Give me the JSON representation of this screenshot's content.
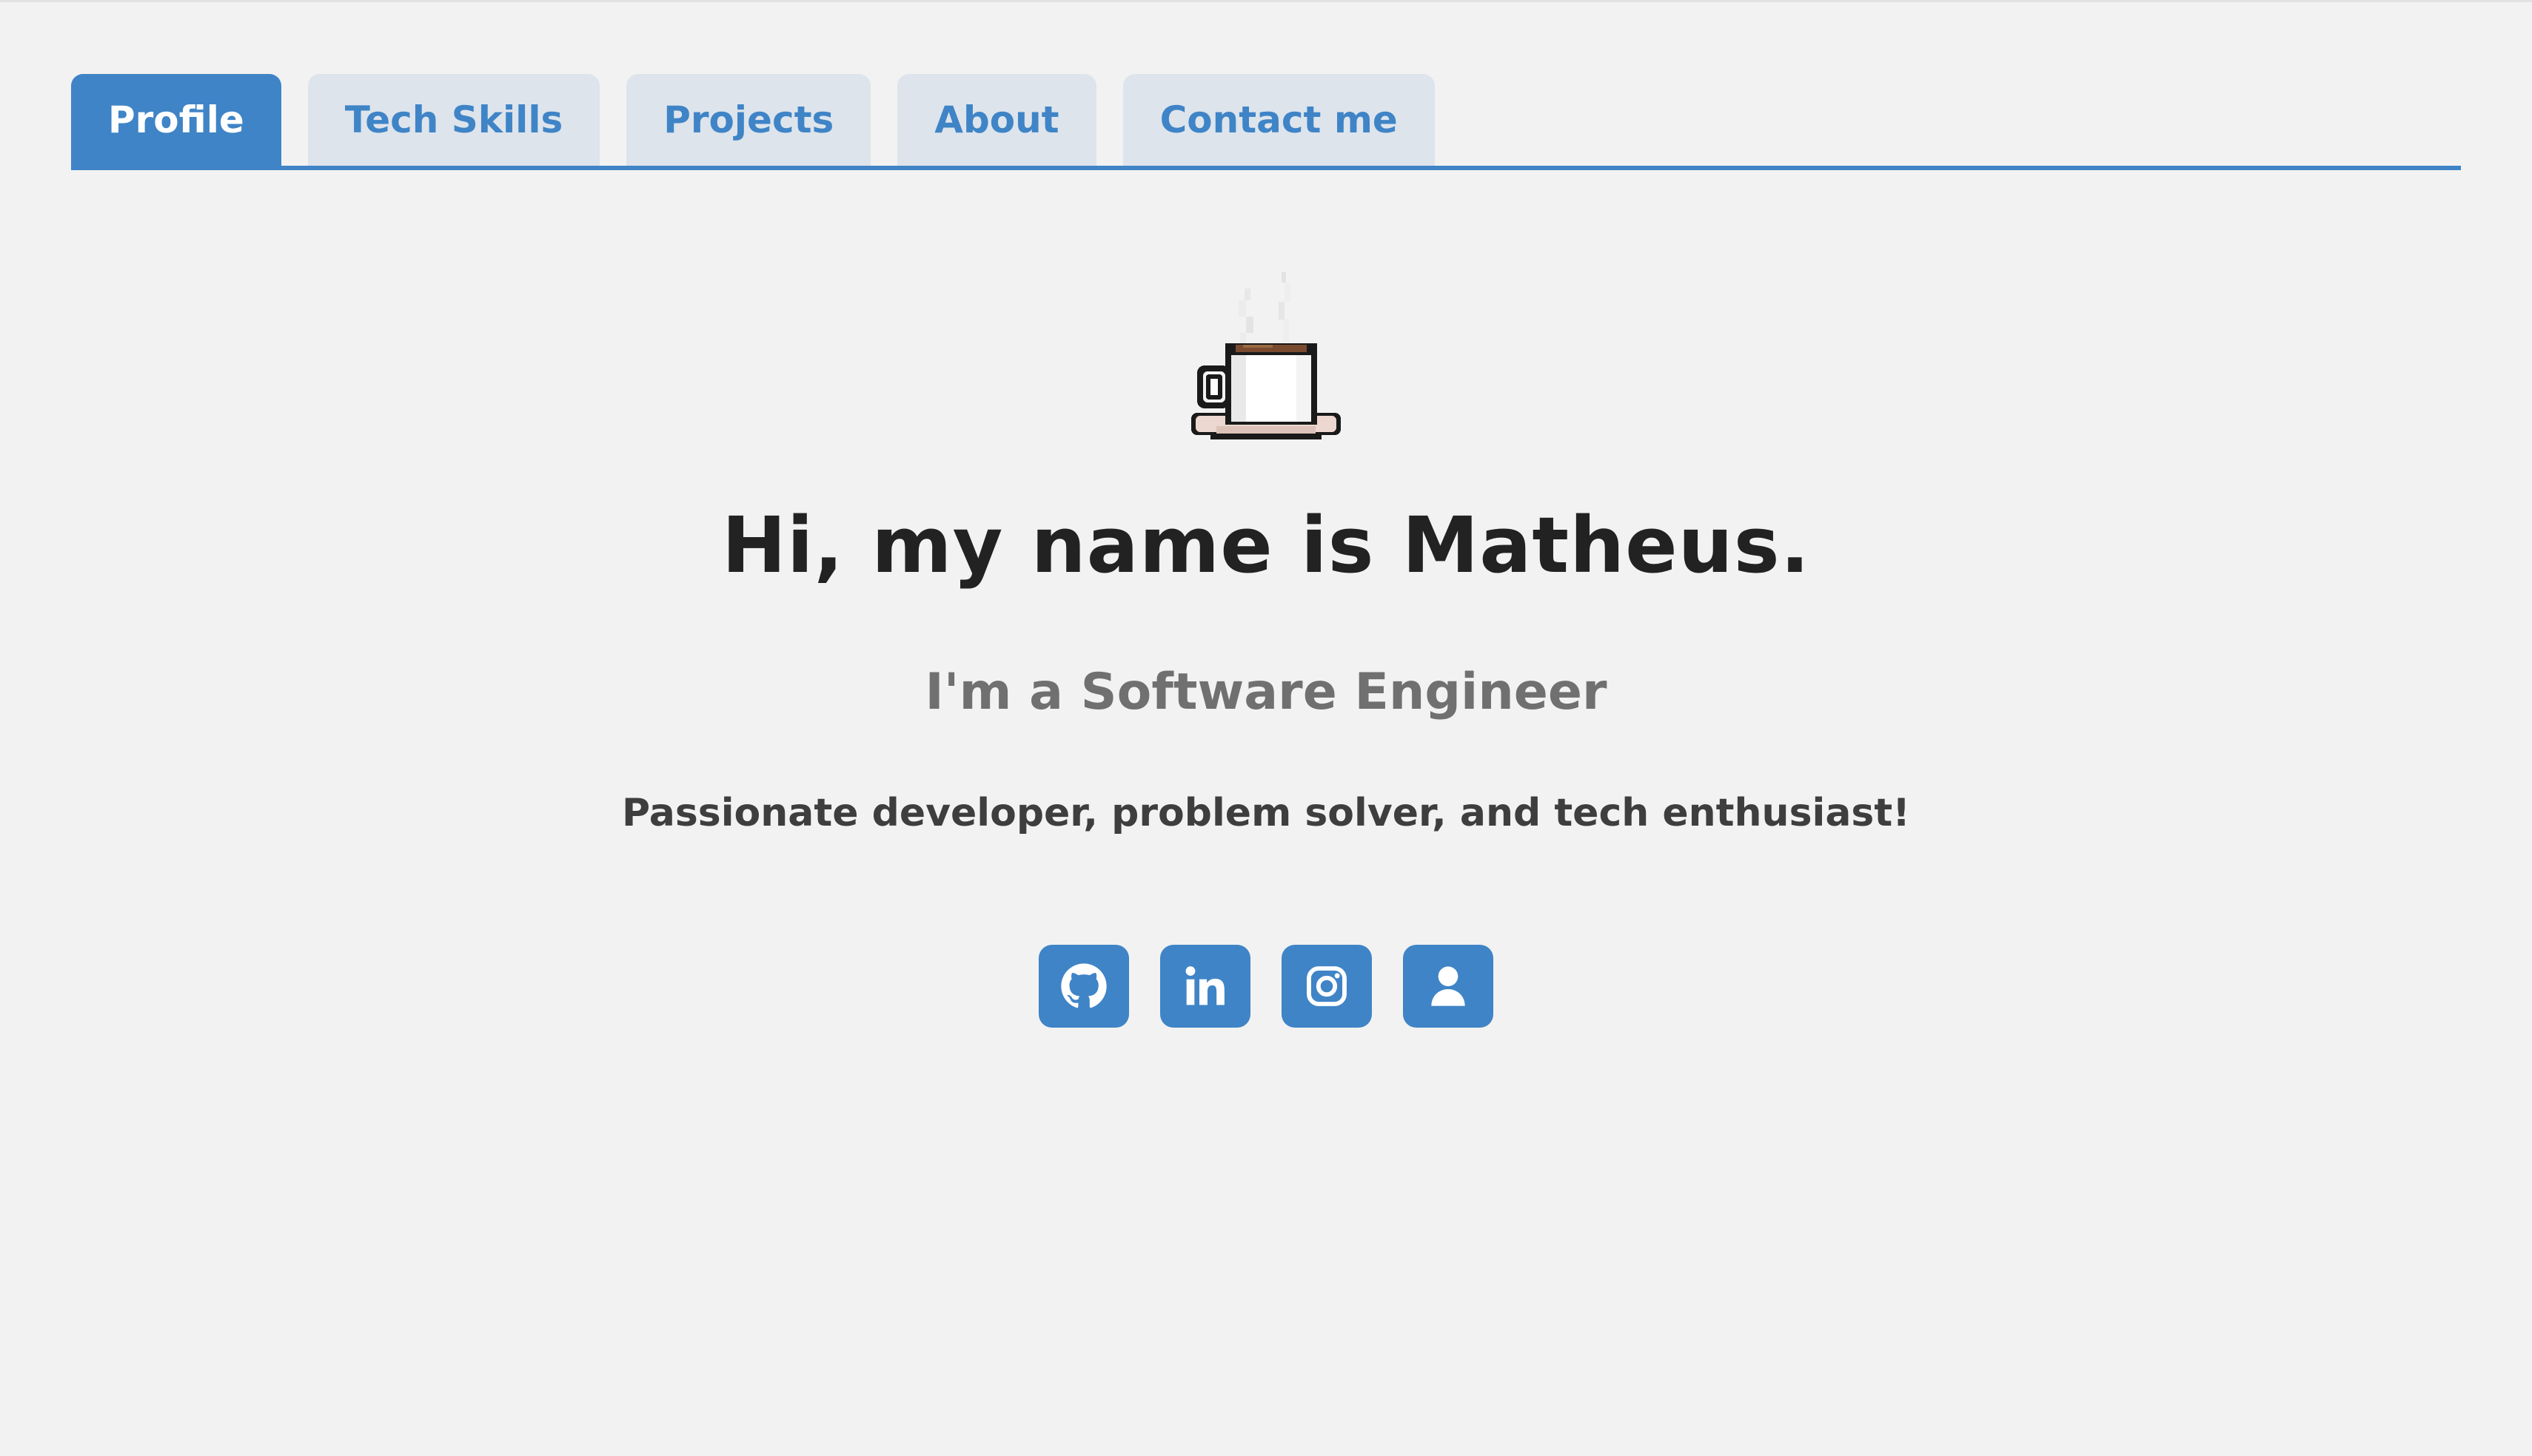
{
  "tabs": [
    {
      "label": "Profile",
      "active": true
    },
    {
      "label": "Tech Skills",
      "active": false
    },
    {
      "label": "Projects",
      "active": false
    },
    {
      "label": "About",
      "active": false
    },
    {
      "label": "Contact me",
      "active": false
    }
  ],
  "hero": {
    "icon": "coffee-cup-icon",
    "title": "Hi, my name is Matheus.",
    "subtitle": "I'm a Software Engineer",
    "tagline": "Passionate developer, problem solver, and tech enthusiast!"
  },
  "socials": [
    {
      "icon": "github-icon"
    },
    {
      "icon": "linkedin-icon"
    },
    {
      "icon": "instagram-icon"
    },
    {
      "icon": "user-icon"
    }
  ],
  "colors": {
    "accent": "#3f84c6",
    "background": "#f2f2f2",
    "tab_inactive": "#dde4ec",
    "title": "#222222",
    "subtitle": "#707070"
  }
}
